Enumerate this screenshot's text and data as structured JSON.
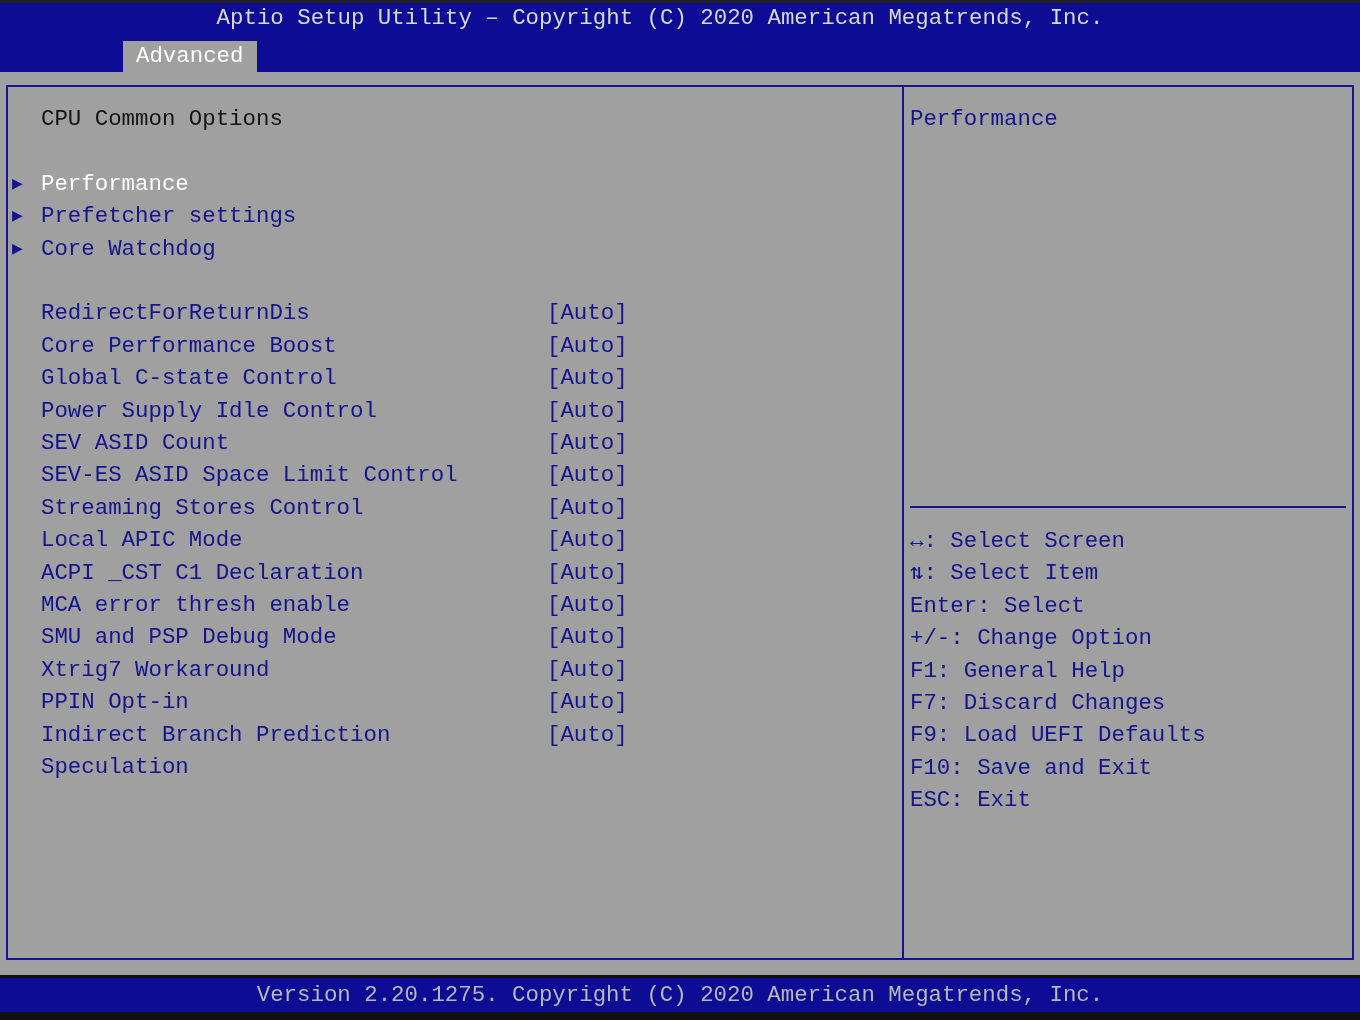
{
  "title": "Aptio Setup Utility – Copyright (C) 2020 American Megatrends, Inc.",
  "tabs": [
    {
      "label": "Advanced",
      "selected": true
    }
  ],
  "page_title": "CPU Common Options",
  "submenus": [
    {
      "arrow": "▶",
      "label": "Performance",
      "selected": true
    },
    {
      "arrow": "▶",
      "label": "Prefetcher settings",
      "selected": false
    },
    {
      "arrow": "▶",
      "label": "Core Watchdog",
      "selected": false
    }
  ],
  "settings": [
    {
      "label": "RedirectForReturnDis",
      "value": "[Auto]"
    },
    {
      "label": "Core Performance Boost",
      "value": "[Auto]"
    },
    {
      "label": "Global C-state Control",
      "value": "[Auto]"
    },
    {
      "label": "Power Supply Idle Control",
      "value": "[Auto]"
    },
    {
      "label": "SEV ASID Count",
      "value": "[Auto]"
    },
    {
      "label": "SEV-ES ASID Space Limit Control",
      "value": "[Auto]"
    },
    {
      "label": "Streaming Stores Control",
      "value": "[Auto]"
    },
    {
      "label": "Local APIC Mode",
      "value": "[Auto]"
    },
    {
      "label": "ACPI _CST C1 Declaration",
      "value": "[Auto]"
    },
    {
      "label": "MCA error thresh enable",
      "value": "[Auto]"
    },
    {
      "label": "SMU and PSP Debug Mode",
      "value": "[Auto]"
    },
    {
      "label": "Xtrig7 Workaround",
      "value": "[Auto]"
    },
    {
      "label": "PPIN Opt-in",
      "value": "[Auto]"
    },
    {
      "label": "Indirect Branch Prediction Speculation",
      "value": "[Auto]"
    }
  ],
  "help_text": "Performance",
  "key_help": [
    "↔: Select Screen",
    "⇅: Select Item",
    "Enter: Select",
    "+/-: Change Option",
    "F1: General Help",
    "F7: Discard Changes",
    "F9: Load UEFI Defaults",
    "F10: Save and Exit",
    "ESC: Exit"
  ],
  "footer": "Version 2.20.1275. Copyright (C) 2020 American Megatrends, Inc."
}
